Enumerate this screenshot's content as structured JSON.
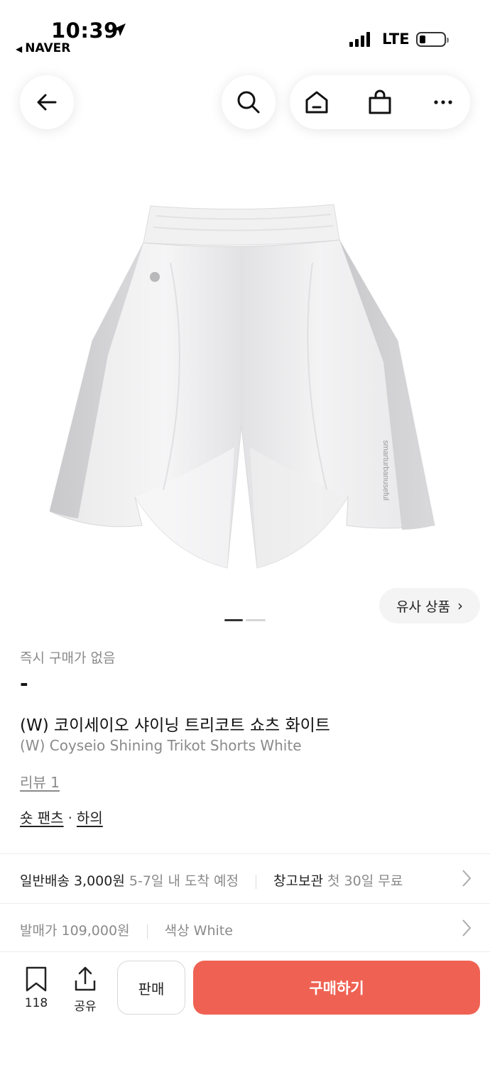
{
  "status_bar": {
    "time": "10:39",
    "back_app": "NAVER",
    "network": "LTE"
  },
  "nav": {
    "back_icon": "arrow-left-icon",
    "search_icon": "search-icon",
    "home_icon": "home-icon",
    "bag_icon": "shopping-bag-icon",
    "more_icon": "more-horizontal-icon"
  },
  "product": {
    "image_icon": "shorts-product-image",
    "similar_label": "유사 상품",
    "pager": {
      "total": 2,
      "current": 1
    },
    "price_label": "즉시 구매가 없음",
    "price_value": "-",
    "title_ko": "(W) 코이세이오 샤이닝 트리코트 쇼츠 화이트",
    "title_en": "(W) Coyseio Shining Trikot Shorts White",
    "review_label": "리뷰 1",
    "category_1": "숏 팬츠",
    "category_sep": "·",
    "category_2": "하의"
  },
  "shipping_row": {
    "label_1": "일반배송",
    "price_1": "3,000원",
    "detail_1": "5-7일 내 도착 예정",
    "label_2": "창고보관",
    "detail_2": "첫 30일 무료"
  },
  "info_row": {
    "release_label": "발매가",
    "release_price": "109,000원",
    "color_label": "색상",
    "color_value": "White"
  },
  "bottom_bar": {
    "bookmark_count": "118",
    "share_label": "공유",
    "sell_label": "판매",
    "buy_label": "구매하기"
  },
  "colors": {
    "accent": "#ef6253",
    "muted_text": "#8a8a8a"
  }
}
